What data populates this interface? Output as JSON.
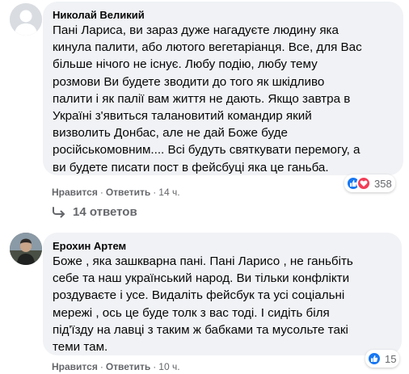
{
  "comments": [
    {
      "author": "Николай Великий",
      "text": "Пані Лариса, ви зараз дуже нагадуєте людину яка\nкинула палити, або лютого вегетаріанця. Все, для Вас\nбільше нічого не існує. Любу подію, любу тему\nрозмови Ви будете зводити до того як шкідливо\nпалити і як палії вам життя не дають. Якщо завтра в\nУкраїні з'явиться талановитий командир який\nвизволить Донбас, але не дай Боже буде\nросійськомовним.... Всі будуть святкувати перемогу, а\nви будете писати пост в фейсбуці яка це ганьба.",
      "like_label": "Нравится",
      "reply_label": "Ответить",
      "time": "14 ч.",
      "reaction_count": "358",
      "reaction_icons": [
        "like-icon",
        "love-icon"
      ],
      "replies_label": "14 ответов"
    },
    {
      "author": "Ерохин Артем",
      "text": "Боже , яка зашкварна пані. Пані Ларисо , не ганьбіть\nсебе та наш український народ. Ви тільки конфлікти\nроздуваєте і усе. Видаліть фейсбук та усі соціальні\nмережі , ось це буде толк з вас тоді. І сидіть біля\nпід'їзду на лавці з таким ж бабками та мусольте такі\nтеми там.",
      "like_label": "Нравится",
      "reply_label": "Ответить",
      "time": "10 ч.",
      "reaction_count": "15",
      "reaction_icons": [
        "like-icon"
      ]
    }
  ],
  "colors": {
    "bubble": "#f0f2f5",
    "meta": "#65676b",
    "like": "#1877f2",
    "love": "#f33e58"
  }
}
